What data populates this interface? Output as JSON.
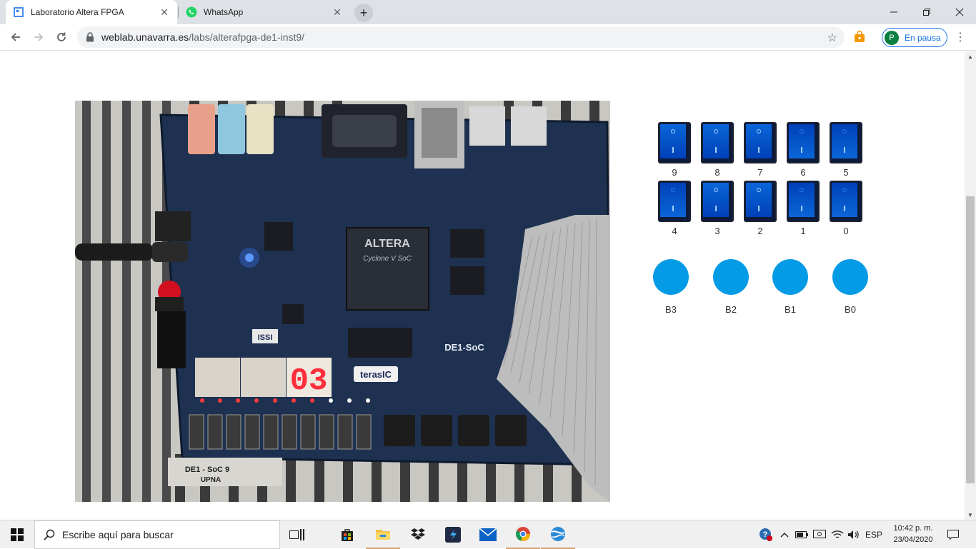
{
  "browser": {
    "tabs": [
      {
        "title": "Laboratorio Altera FPGA",
        "active": true,
        "icon": "weblab-favicon"
      },
      {
        "title": "WhatsApp",
        "active": false,
        "icon": "whatsapp-icon"
      }
    ],
    "url_host": "weblab.unavarra.es",
    "url_path": "/labs/alterafpga-de1-inst9/",
    "profile_initial": "P",
    "profile_status": "En pausa"
  },
  "lab": {
    "switches_row1": [
      "9",
      "8",
      "7",
      "6",
      "5"
    ],
    "switches_row2": [
      "4",
      "3",
      "2",
      "1",
      "0"
    ],
    "switch_states": {
      "9": "off",
      "8": "off",
      "7": "off",
      "6": "on",
      "5": "on",
      "4": "off",
      "3": "off",
      "2": "off",
      "1": "on",
      "0": "on"
    },
    "buttons": [
      "B3",
      "B2",
      "B1",
      "B0"
    ],
    "button_color": "#039be5",
    "camera": {
      "hex_display": "03",
      "board_label": "DE1-SoC",
      "chip_brand": "ALTERA",
      "chip_family": "Cyclone V SoC",
      "vendor": "terasIC",
      "memory_brand": "ISSI",
      "board_tag": "DE1 - SoC 9",
      "board_tag_2": "UPNA"
    }
  },
  "taskbar": {
    "search_placeholder": "Escribe aquí para buscar",
    "language": "ESP",
    "time": "10:42 p. m.",
    "date": "23/04/2020"
  }
}
